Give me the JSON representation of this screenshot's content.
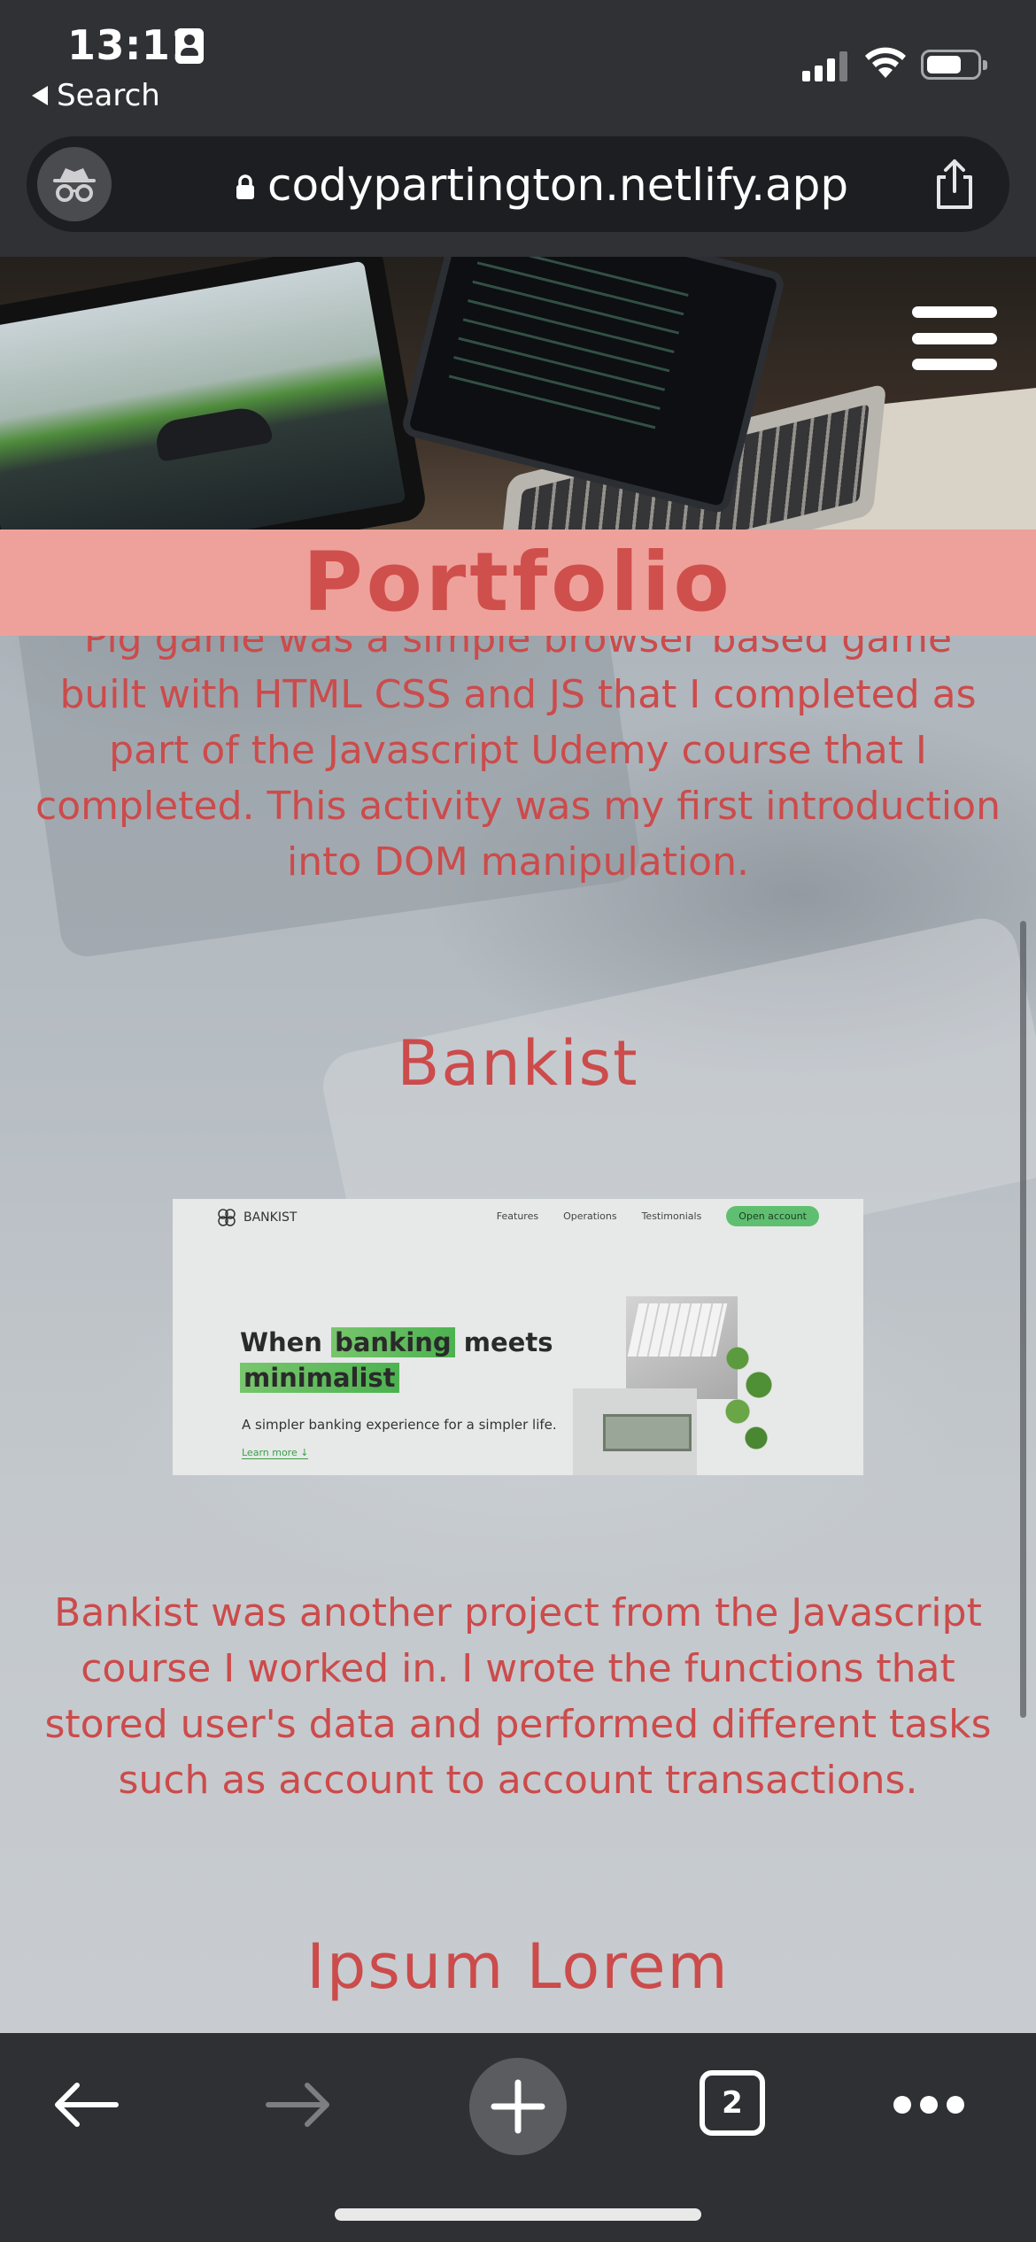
{
  "status_bar": {
    "time": "13:11",
    "back_app_label": "Search"
  },
  "browser": {
    "url": "codypartington.netlify.app",
    "open_tabs_count": "2"
  },
  "page": {
    "banner_title": "Portfolio",
    "pig_game_description": "Pig game was a simple browser based game built with HTML CSS and JS that I completed as part of the Javascript Udemy course that I completed. This activity was my first introduction into DOM manipulation.",
    "bankist": {
      "title": "Bankist",
      "description": "Bankist was another project from the Javascript course I worked in. I wrote the functions that stored user's data and performed different tasks such as account to account transactions.",
      "screenshot": {
        "logo": "BANKIST",
        "nav": [
          "Features",
          "Operations",
          "Testimonials"
        ],
        "cta": "Open account",
        "headline_word1": "When",
        "headline_word2": "banking",
        "headline_word3": "meets",
        "headline_word4": "minimalist",
        "subtitle": "A simpler banking experience for a simpler life.",
        "learn_more": "Learn more ↓"
      }
    },
    "next_section_title": "Ipsum Lorem"
  },
  "colors": {
    "accent_text": "#cc4b4b",
    "banner_bg": "#eea19a",
    "chrome_bg": "#303135"
  }
}
